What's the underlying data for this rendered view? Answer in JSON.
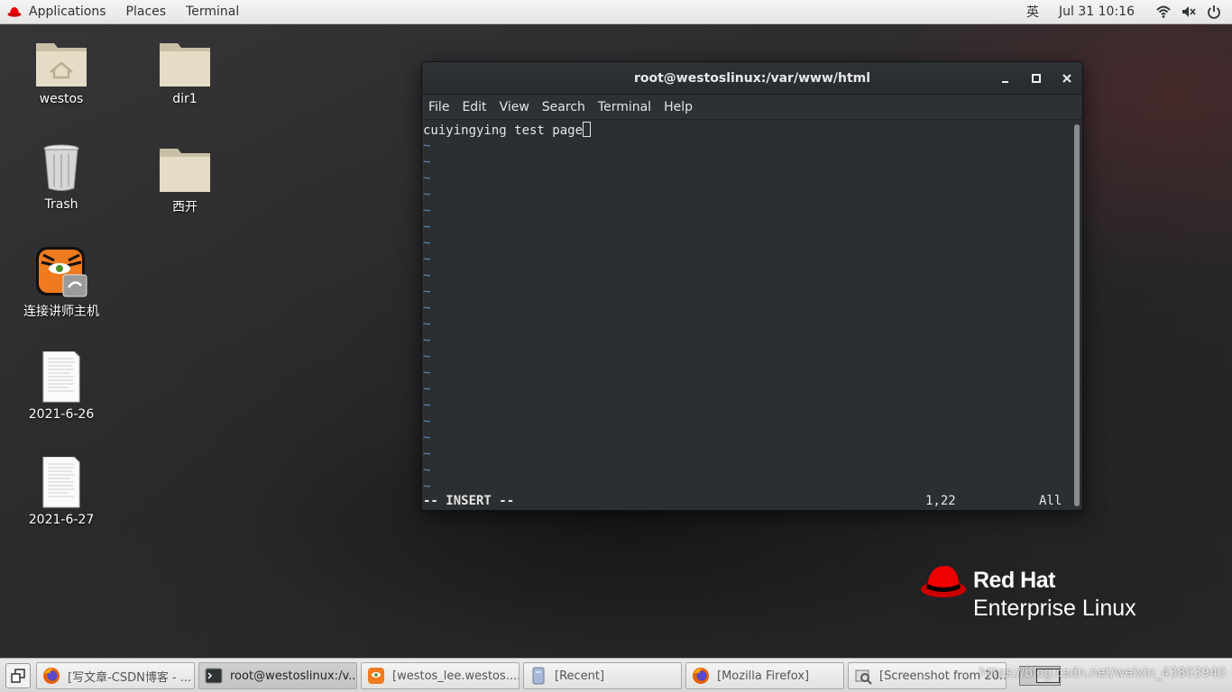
{
  "topbar": {
    "applications": "Applications",
    "places": "Places",
    "terminal": "Terminal",
    "input_method": "英",
    "clock": "Jul 31  10:16",
    "icons": [
      "wifi-icon",
      "volume-icon",
      "power-icon"
    ]
  },
  "desktop": {
    "icons": [
      {
        "label": "westos",
        "type": "home-folder"
      },
      {
        "label": "dir1",
        "type": "folder"
      },
      {
        "label": "Trash",
        "type": "trash"
      },
      {
        "label": "西开",
        "type": "folder"
      },
      {
        "label": "连接讲师主机",
        "type": "app-launcher"
      },
      {
        "label": "2021-6-26",
        "type": "document"
      },
      {
        "label": "2021-6-27",
        "type": "document"
      }
    ]
  },
  "terminal": {
    "title": "root@westoslinux:/var/www/html",
    "menu": [
      "File",
      "Edit",
      "View",
      "Search",
      "Terminal",
      "Help"
    ],
    "first_line": "cuiyingying test page",
    "tilde": "~",
    "tilde_count": 22,
    "mode": "-- INSERT --",
    "position": "1,22",
    "scroll": "All"
  },
  "branding": {
    "line1": "Red Hat",
    "line2": "Enterprise Linux",
    "color": "#ee0000"
  },
  "taskbar": {
    "tasks": [
      {
        "label": "[写文章-CSDN博客 - ...",
        "icon": "firefox-icon",
        "active": false
      },
      {
        "label": "root@westoslinux:/v...",
        "icon": "terminal-icon",
        "active": true
      },
      {
        "label": "[westos_lee.westos....",
        "icon": "tiger-icon",
        "active": false
      },
      {
        "label": "[Recent]",
        "icon": "files-icon",
        "active": false
      },
      {
        "label": "[Mozilla Firefox]",
        "icon": "firefox-icon",
        "active": false
      },
      {
        "label": "[Screenshot from 20...",
        "icon": "screenshot-icon",
        "active": false
      }
    ],
    "watermark": "https://blog.csdn.net/weixin_43803940"
  }
}
